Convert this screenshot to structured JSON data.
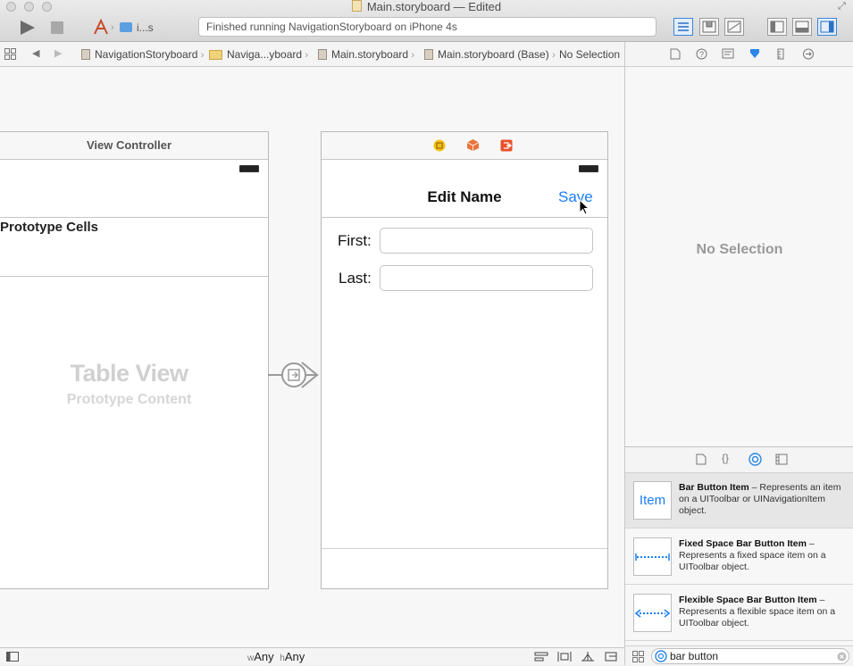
{
  "window": {
    "title": "Main.storyboard — Edited",
    "scheme": "i...s",
    "status": "Finished running NavigationStoryboard on iPhone 4s"
  },
  "jumpbar": {
    "crumbs": [
      "NavigationStoryboard",
      "Naviga...yboard",
      "Main.storyboard",
      "Main.storyboard (Base)",
      "No Selection"
    ]
  },
  "canvas": {
    "table_scene": {
      "title": "View Controller",
      "section_header": "Prototype Cells",
      "placeholder_title": "Table View",
      "placeholder_subtitle": "Prototype Content"
    },
    "edit_scene": {
      "nav_title": "Edit Name",
      "save_label": "Save",
      "first_label": "First:",
      "last_label": "Last:",
      "first_value": "",
      "last_value": ""
    }
  },
  "bottombar": {
    "w_prefix": "w",
    "w_value": "Any",
    "h_prefix": "h",
    "h_value": "Any"
  },
  "inspector": {
    "empty_text": "No Selection"
  },
  "library": {
    "items": [
      {
        "thumb": "Item",
        "title": "Bar Button Item",
        "desc": " – Represents an item on a UIToolbar or UINavigationItem object."
      },
      {
        "thumb": "",
        "title": "Fixed Space Bar Button Item",
        "desc": " – Represents a fixed space item on a UIToolbar object."
      },
      {
        "thumb": "",
        "title": "Flexible Space Bar Button Item",
        "desc": " – Represents a flexible space item on a UIToolbar object."
      }
    ],
    "filter_value": "bar button"
  },
  "colors": {
    "accent": "#1a7ef5",
    "selection": "#e6e6e6"
  }
}
